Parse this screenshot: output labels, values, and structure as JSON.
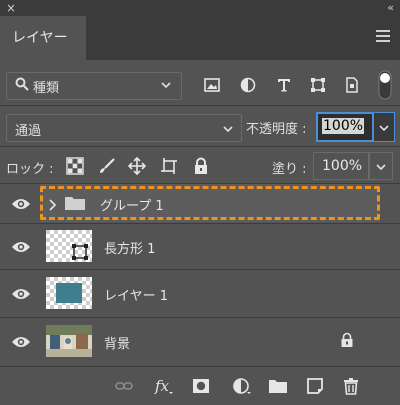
{
  "window": {
    "close_glyph": "×",
    "collapse_glyph": "‹‹"
  },
  "tab": {
    "label": "レイヤー"
  },
  "filter": {
    "kind_label": "種類",
    "icons": [
      "pixel-filter-icon",
      "adjustment-filter-icon",
      "type-filter-icon",
      "shape-filter-icon",
      "smart-object-filter-icon"
    ]
  },
  "blend": {
    "mode": "通過",
    "opacity_label": "不透明度 :",
    "opacity_value": "100%"
  },
  "lock": {
    "label": "ロック :",
    "fill_label": "塗り :",
    "fill_value": "100%"
  },
  "layers": [
    {
      "name": "グループ 1",
      "type": "group",
      "selected": true
    },
    {
      "name": "長方形 1",
      "type": "shape"
    },
    {
      "name": "レイヤー 1",
      "type": "pixel"
    },
    {
      "name": "背景",
      "type": "background",
      "locked": true
    }
  ],
  "colors": {
    "panel": "#535353",
    "header": "#3b3b3b",
    "accent_blue": "#4a90d9",
    "highlight_dash": "#f0921e",
    "swatch_teal": "#3e7e8e"
  }
}
